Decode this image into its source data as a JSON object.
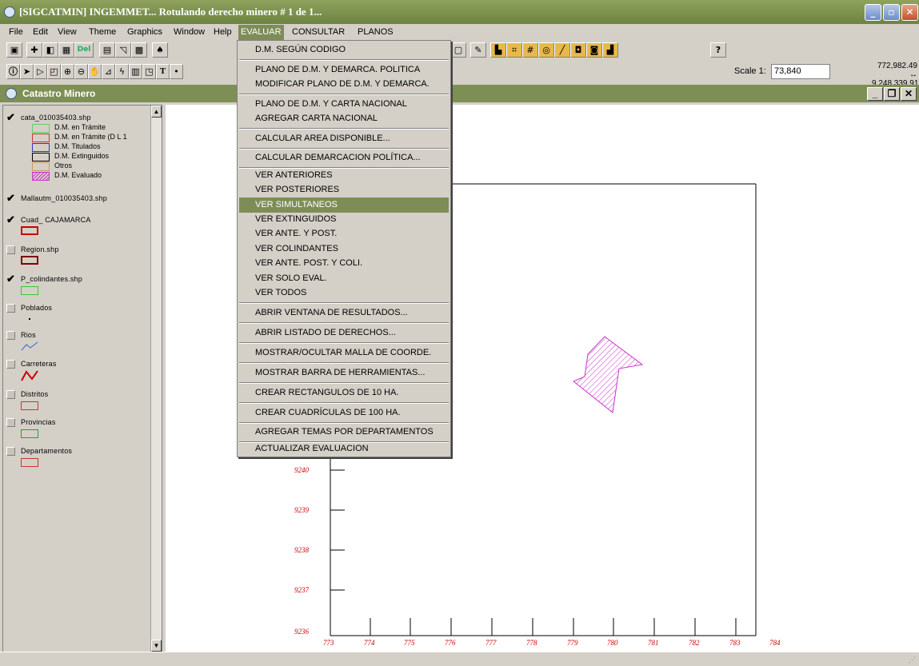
{
  "window": {
    "title": "[SIGCATMIN] INGEMMET... Rotulando derecho minero # 1 de 1...",
    "minimize_glyph": "_",
    "restore_glyph": "▫",
    "close_glyph": "✕",
    "accent": "#7e8d58"
  },
  "menubar": {
    "items": [
      "File",
      "Edit",
      "View",
      "Theme",
      "Graphics",
      "Window",
      "Help",
      "EVALUAR",
      "CONSULTAR",
      "PLANOS"
    ],
    "active": "EVALUAR"
  },
  "toolbar": {
    "del_label": "Del",
    "help_glyph": "?",
    "scale_label": "Scale 1:",
    "scale_value": "73,840",
    "coord_x": "772,982.49",
    "coord_y": "9,248,339.91",
    "text_tool": "T"
  },
  "document": {
    "title": "Catastro Minero",
    "min_glyph": "_",
    "restore_glyph": "❐",
    "close_glyph": "✕"
  },
  "toc": {
    "themes": [
      {
        "name": "cata_010035403.shp",
        "checked": true
      },
      {
        "name": "Mallautm_010035403.shp",
        "checked": true
      },
      {
        "name": "Cuad_ CAJAMARCA",
        "checked": true
      },
      {
        "name": "Region.shp",
        "checked": false
      },
      {
        "name": "P_colindantes.shp",
        "checked": true
      },
      {
        "name": "Poblados",
        "checked": false
      },
      {
        "name": "Rios",
        "checked": false
      },
      {
        "name": "Carreteras",
        "checked": false
      },
      {
        "name": "Distritos",
        "checked": false
      },
      {
        "name": "Provincias",
        "checked": false
      },
      {
        "name": "Departamentos",
        "checked": false
      }
    ],
    "cata_legend": [
      {
        "label": "D.M. en Trámite",
        "color": "#66cc66"
      },
      {
        "label": "D.M. en Trámite (D L 1",
        "color": "#cc3333"
      },
      {
        "label": "D.M. Titulados",
        "color": "#3333cc"
      },
      {
        "label": "D.M. Extinguidos",
        "color": "#000000"
      },
      {
        "label": "Otros",
        "color": "#cc9966"
      },
      {
        "label": "D.M. Evaluado",
        "color": "#cc33cc"
      }
    ]
  },
  "dropdown": {
    "highlighted": "VER SIMULTANEOS",
    "items": [
      "D.M. SEGÚN CODIGO",
      "PLANO DE D.M. Y DEMARCA. POLITICA",
      "MODIFICAR PLANO DE D.M. Y DEMARCA.",
      "PLANO DE D.M. Y CARTA NACIONAL",
      "AGREGAR CARTA NACIONAL",
      "CALCULAR AREA DISPONIBLE...",
      "CALCULAR DEMARCACION POLÍTICA...",
      "VER ANTERIORES",
      "VER POSTERIORES",
      "VER SIMULTANEOS",
      "VER EXTINGUIDOS",
      "VER ANTE. Y POST.",
      "VER COLINDANTES",
      "VER ANTE. POST. Y COLI.",
      "VER SOLO EVAL.",
      "VER TODOS",
      "ABRIR VENTANA DE RESULTADOS...",
      "ABRIR LISTADO DE DERECHOS...",
      "MOSTRAR/OCULTAR MALLA DE COORDE.",
      "MOSTRAR BARRA DE HERRAMIENTAS...",
      "CREAR RECTANGULOS DE 10 HA.",
      "CREAR CUADRÍCULAS DE 100 HA.",
      "AGREGAR TEMAS POR DEPARTAMENTOS",
      "ACTUALIZAR EVALUACION"
    ]
  },
  "map": {
    "y_ticks": [
      "9240",
      "9239",
      "9238",
      "9237",
      "9236"
    ],
    "x_ticks": [
      "773",
      "774",
      "775",
      "776",
      "777",
      "778",
      "779",
      "780",
      "781",
      "782",
      "783",
      "784"
    ],
    "tick_color": "#cc0000",
    "evaluated_color": "#cc33cc"
  }
}
